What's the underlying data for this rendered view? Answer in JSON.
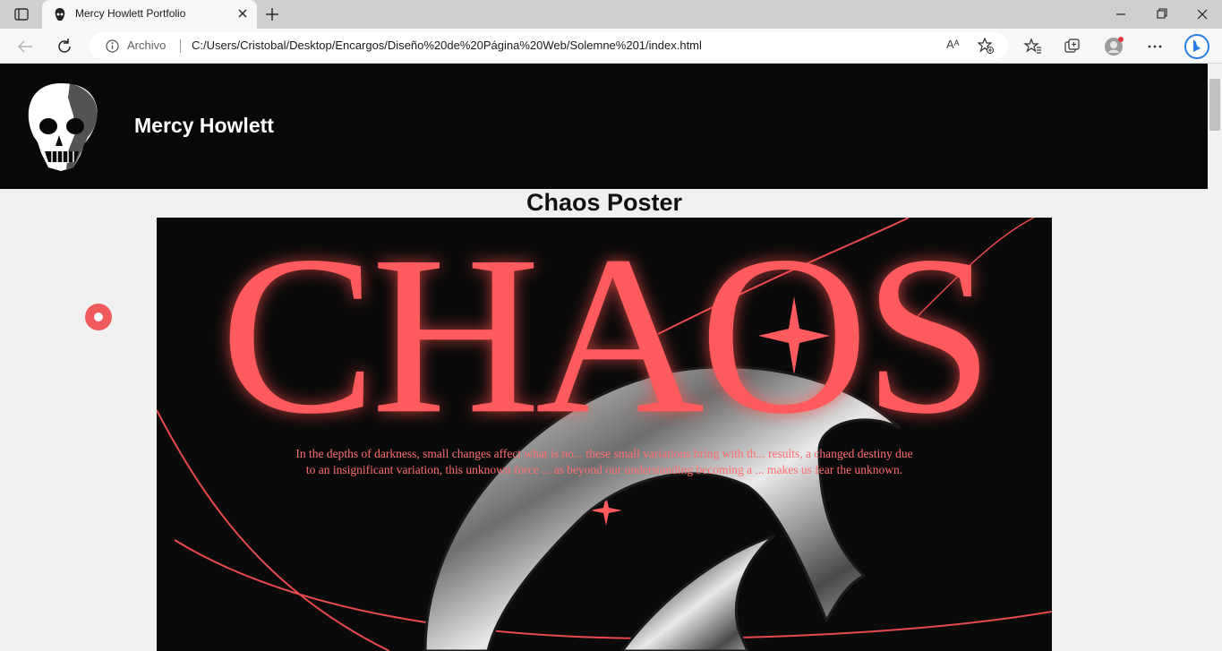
{
  "browser": {
    "tab_title": "Mercy Howlett Portfolio",
    "address_prefix": "Archivo",
    "url": "C:/Users/Cristobal/Desktop/Encargos/Diseño%20de%20Página%20Web/Solemne%201/index.html",
    "read_aloud_label": "Aᴬ",
    "icons": [
      "tab-actions-icon",
      "skull-favicon-icon",
      "close-icon",
      "plus-icon",
      "minimize-icon",
      "restore-icon",
      "close-window-icon",
      "back-arrow-icon",
      "refresh-icon",
      "info-icon",
      "add-favorite-icon",
      "favorites-icon",
      "collections-icon",
      "profile-icon",
      "more-icon",
      "bing-icon"
    ]
  },
  "site": {
    "name": "Mercy Howlett"
  },
  "section": {
    "title": "Chaos Poster"
  },
  "poster": {
    "word": "CHAOS",
    "line1": "In the depths of darkness, small changes affect what is no... these small variations bring with th... results, a changed destiny due",
    "line2": "to an insignificant variation, this unknown force ... as beyond our understanding becoming a ... makes us fear the unknown.",
    "accent_color": "#ff5b5e"
  },
  "colors": {
    "header_bg": "#080808",
    "page_bg": "#f0f0f0",
    "cursor": "#f05a5c"
  }
}
